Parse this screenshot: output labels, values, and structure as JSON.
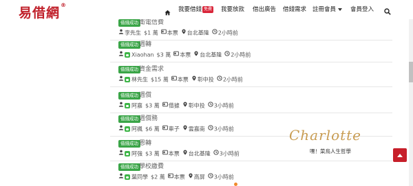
{
  "brand": {
    "logo_text": "易借網",
    "logo_mark": "®"
  },
  "nav": {
    "home_icon": "home-icon",
    "items": [
      {
        "label": "我要借錢",
        "badge": "免費"
      },
      {
        "label": "我要放款"
      },
      {
        "label": "借出廣告"
      },
      {
        "label": "借錢需求"
      },
      {
        "label": "註冊會員",
        "has_dropdown": true
      },
      {
        "label": "會員登入"
      }
    ],
    "search_icon": "search-icon"
  },
  "listings": [
    {
      "badge": "借錢成功",
      "title": "衛電信費",
      "contact_type": "user",
      "name": "李先生",
      "amount": "$1 萬",
      "job": "本票",
      "location": "台北基隆",
      "time": "2小時前"
    },
    {
      "badge": "借錢成功",
      "title": "週轉",
      "contact_type": "line",
      "name": "Xiaohan",
      "amount": "$3 萬",
      "job": "本票",
      "location": "台北基隆",
      "time": "2小時前"
    },
    {
      "badge": "借錢成功",
      "title": "資金需求",
      "contact_type": "line",
      "name": "林先生",
      "amount": "$15 萬",
      "job": "本票",
      "location": "彰中投",
      "time": "2小時前"
    },
    {
      "badge": "借錢成功",
      "title": "週償",
      "contact_type": "line",
      "name": "阿嘉",
      "amount": "$3 萬",
      "job": "借據",
      "location": "彰中投",
      "time": "3小時前"
    },
    {
      "badge": "借錢成功",
      "title": "週償務",
      "contact_type": "line",
      "name": "阿楓",
      "amount": "$6 萬",
      "job": "車子",
      "location": "雲嘉南",
      "time": "3小時前"
    },
    {
      "badge": "借錢成功",
      "title": "恩轉",
      "contact_type": "line",
      "name": "阿強",
      "amount": "$3 萬",
      "job": "本票",
      "location": "台北基隆",
      "time": "3小時前"
    },
    {
      "badge": "借錢成功",
      "title": "學校繳費",
      "contact_type": "line",
      "name": "葉同學",
      "amount": "$2 萬",
      "job": "本票",
      "location": "高屏",
      "time": "3小時前"
    }
  ],
  "watermark": {
    "script": "Charlotte",
    "subtitle": "嘿！菜鳥人生哲學"
  },
  "colors": {
    "brand_red": "#c0202a",
    "success_green": "#3aa547",
    "line_green": "#3fb548",
    "watermark_gold": "#c89c52"
  }
}
